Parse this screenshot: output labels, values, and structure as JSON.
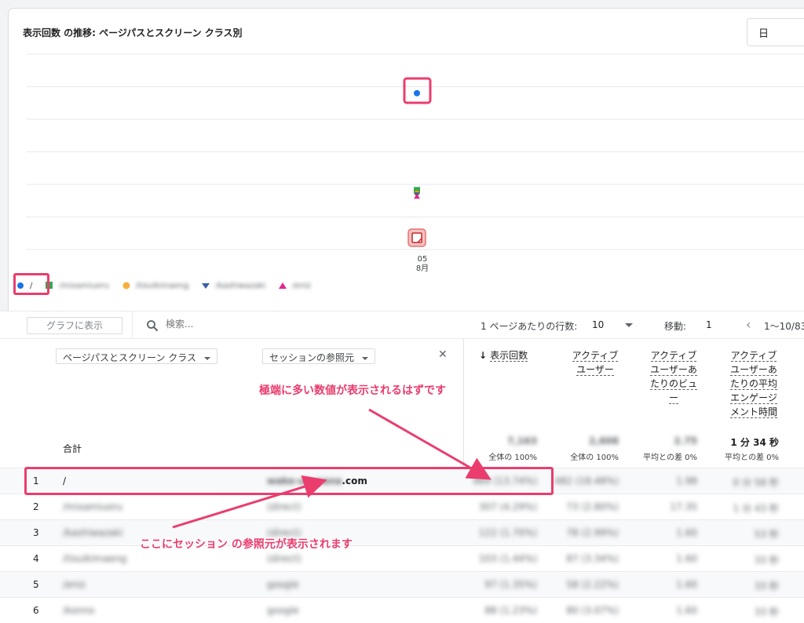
{
  "header": {
    "chart_title": "表示回数 の推移: ページパスとスクリーン クラス別",
    "period_select": "日"
  },
  "chart_data": {
    "type": "scatter",
    "title": "表示回数 の推移: ページパスとスクリーン クラス別",
    "x": [
      "05 8月"
    ],
    "x_tick_day": "05",
    "x_tick_month": "8月",
    "grid": true,
    "series": [
      {
        "name": "/",
        "color": "#1a73e8",
        "marker": "circle",
        "values": [
          1
        ]
      },
      {
        "name": "/mixamiuoru",
        "color": "#34a853",
        "marker": "square",
        "values": [
          0.38
        ]
      },
      {
        "name": "/tisuikimaeng",
        "color": "#f29900",
        "marker": "circle",
        "values": [
          0.36
        ]
      },
      {
        "name": "/kashiwazaki",
        "color": "#3b5fa8",
        "marker": "diamond",
        "values": [
          0.35
        ]
      },
      {
        "name": "/eniz",
        "color": "#e52592",
        "marker": "triangle",
        "values": [
          0.34
        ]
      }
    ],
    "annotation_icon": "note-icon"
  },
  "legend_items": [
    "/",
    "/mixamiuoru",
    "/tisuikimaeng",
    "/kashiwazaki",
    "/eniz"
  ],
  "toolbar": {
    "graph_button": "グラフに表示",
    "search_placeholder": "検索...",
    "rows_per_page_label": "1 ページあたりの行数:",
    "rows_per_page_value": "10",
    "goto_label": "移動:",
    "goto_value": "1",
    "range_text": "1〜10/83"
  },
  "table": {
    "dim1": "ページパスとスクリーン クラス",
    "dim2": "セッションの参照元",
    "metrics": [
      {
        "lines": [
          "表示回数"
        ],
        "sorted": true
      },
      {
        "lines": [
          "アクティブ",
          "ユーザー"
        ]
      },
      {
        "lines": [
          "アクティブ",
          "ユーザーあ",
          "たりのビュ",
          "ー"
        ]
      },
      {
        "lines": [
          "アクティブ",
          "ユーザーあ",
          "たりの平均",
          "エンゲージ",
          "メント時間"
        ]
      }
    ],
    "total_label": "合計",
    "totals": [
      "7,163",
      "2,608",
      "2.75",
      "1 分 34 秒"
    ],
    "totals_sub": [
      "全体の 100%",
      "全体の 100%",
      "平均との差 0%",
      "平均との差 0%"
    ],
    "rows": [
      {
        "idx": "1",
        "path": "/",
        "src_blur": "wake-up-pana",
        "src_suffix": ".com",
        "m": [
          "984 (13.74%)",
          "482 (18.48%)",
          "1.98",
          "0 分 58 秒"
        ]
      },
      {
        "idx": "2",
        "path": "/mixamiuoru",
        "src": "(direct)",
        "m": [
          "307 (4.29%)",
          "73 (2.80%)",
          "17.35",
          "1 分 43 秒"
        ]
      },
      {
        "idx": "3",
        "path": "/kashiwazaki",
        "src": "(direct)",
        "m": [
          "122 (1.70%)",
          "78 (2.99%)",
          "1.60",
          "53 秒"
        ]
      },
      {
        "idx": "4",
        "path": "/tisuikimaeng",
        "src": "(direct)",
        "m": [
          "103 (1.44%)",
          "87 (3.34%)",
          "1.60",
          "33 秒"
        ]
      },
      {
        "idx": "5",
        "path": "/eniz",
        "src": "google",
        "m": [
          "97 (1.35%)",
          "58 (2.22%)",
          "1.60",
          "33 秒"
        ]
      },
      {
        "idx": "6",
        "path": "/konno",
        "src": "google",
        "m": [
          "88 (1.23%)",
          "80 (3.07%)",
          "1.60",
          "33 秒"
        ]
      }
    ]
  },
  "annotations": {
    "callout_top": "極端に多い数値が表示されるはずです",
    "callout_bottom": "ここにセッション の参照元が表示されます",
    "accent_color": "#ea3d6e"
  }
}
